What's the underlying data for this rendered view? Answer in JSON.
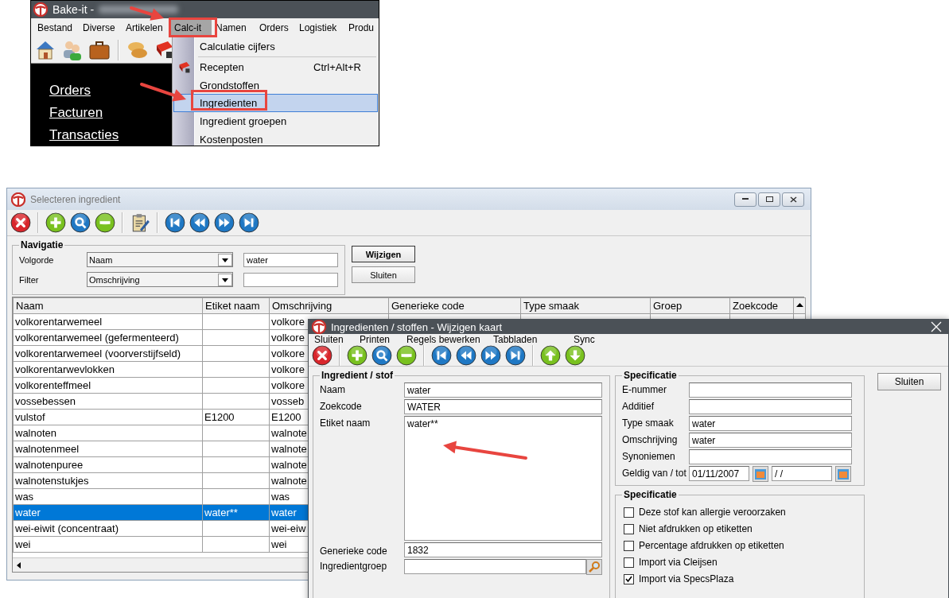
{
  "top_screenshot": {
    "title": "Bake-it -",
    "menu": [
      {
        "label": "Bestand",
        "selected": false
      },
      {
        "label": "Diverse",
        "selected": false
      },
      {
        "label": "Artikelen",
        "selected": false
      },
      {
        "label": "Calc-it",
        "selected": true
      },
      {
        "label": "Namen",
        "selected": false
      },
      {
        "label": "Orders",
        "selected": false
      },
      {
        "label": "Logistiek",
        "selected": false
      },
      {
        "label": "Produ",
        "selected": false
      }
    ],
    "side_links": [
      "Orders",
      "Facturen",
      "Transacties"
    ],
    "dropdown": [
      {
        "label": "Calculatie cijfers",
        "selected": false
      },
      {
        "label": "Recepten",
        "shortcut": "Ctrl+Alt+R",
        "selected": false
      },
      {
        "label": "Grondstoffen",
        "selected": false
      },
      {
        "label": "Ingredienten",
        "selected": true
      },
      {
        "label": "Ingredient groepen",
        "selected": false
      },
      {
        "label": "Kostenposten",
        "selected": false
      }
    ]
  },
  "list_window": {
    "title": "Selecteren ingredient",
    "group_title": "Navigatie",
    "fields": [
      {
        "label": "Volgorde",
        "select": "Naam",
        "value": "water"
      },
      {
        "label": "Filter",
        "select": "Omschrijving"
      }
    ],
    "buttons": [
      {
        "label": "Wijzigen",
        "default": true
      },
      {
        "label": "Sluiten",
        "default": false
      }
    ],
    "table": {
      "columns": [
        "Naam",
        "Etiket naam",
        "Omschrijving",
        "Generieke code",
        "Type smaak",
        "Groep",
        "Zoekcode"
      ],
      "rows": [
        {
          "cells": [
            "volkorentarwemeel",
            "",
            "volkore"
          ],
          "selected": false
        },
        {
          "cells": [
            "volkorentarwemeel (gefermenteerd)",
            "",
            "volkore"
          ],
          "selected": false
        },
        {
          "cells": [
            "volkorentarwemeel (voorverstijfseld)",
            "",
            "volkore"
          ],
          "selected": false
        },
        {
          "cells": [
            "volkorentarwevlokken",
            "",
            "volkore"
          ],
          "selected": false
        },
        {
          "cells": [
            "volkorenteffmeel",
            "",
            "volkore"
          ],
          "selected": false
        },
        {
          "cells": [
            "vossebessen",
            "",
            "vosseb"
          ],
          "selected": false
        },
        {
          "cells": [
            "vulstof",
            "E1200",
            "E1200"
          ],
          "selected": false
        },
        {
          "cells": [
            "walnoten",
            "",
            "walnote"
          ],
          "selected": false
        },
        {
          "cells": [
            "walnotenmeel",
            "",
            "walnote"
          ],
          "selected": false
        },
        {
          "cells": [
            "walnotenpuree",
            "",
            "walnote"
          ],
          "selected": false
        },
        {
          "cells": [
            "walnotenstukjes",
            "",
            "walnote"
          ],
          "selected": false
        },
        {
          "cells": [
            "was",
            "",
            "was"
          ],
          "selected": false
        },
        {
          "cells": [
            "water",
            "water**",
            "water"
          ],
          "selected": true
        },
        {
          "cells": [
            "wei-eiwit (concentraat)",
            "",
            "wei-eiw"
          ],
          "selected": false
        },
        {
          "cells": [
            "wei",
            "",
            "wei"
          ],
          "selected": false
        }
      ]
    }
  },
  "dialog": {
    "title": "Ingredienten / stoffen - Wijzigen kaart",
    "menu": [
      "Sluiten",
      "Printen",
      "Regels bewerken",
      "Tabbladen",
      "Sync"
    ],
    "main_group": {
      "title": "Ingredient / stof",
      "fields": [
        {
          "label": "Naam",
          "kind": "text",
          "value": "water"
        },
        {
          "label": "Zoekcode",
          "kind": "text",
          "value": "WATER"
        },
        {
          "label": "Etiket naam",
          "kind": "textarea",
          "value": "water**"
        },
        {
          "label": "Generieke code",
          "kind": "text",
          "value": "1832"
        },
        {
          "label": "Ingredientgroep",
          "kind": "lookup"
        }
      ]
    },
    "spec_group": {
      "title": "Specificatie",
      "fields": [
        {
          "label": "E-nummer",
          "kind": "text"
        },
        {
          "label": "Additief",
          "kind": "text"
        },
        {
          "label": "Type smaak",
          "kind": "text",
          "value": "water"
        },
        {
          "label": "Omschrijving",
          "kind": "text",
          "value": "water"
        },
        {
          "label": "Synoniemen",
          "kind": "text"
        },
        {
          "label": "Geldig van / tot",
          "kind": "date",
          "values": [
            "01/11/2007",
            "/ /"
          ]
        }
      ]
    },
    "options_group": {
      "title": "Specificatie",
      "options": [
        {
          "label": "Deze stof kan allergie veroorzaken",
          "checked": false
        },
        {
          "label": "Niet afdrukken op etiketten",
          "checked": false
        },
        {
          "label": "Percentage afdrukken op etiketten",
          "checked": false
        },
        {
          "label": "Import via Cleijsen",
          "checked": false
        },
        {
          "label": "Import via SpecsPlaza",
          "checked": true
        }
      ]
    },
    "button": "Sluiten"
  }
}
